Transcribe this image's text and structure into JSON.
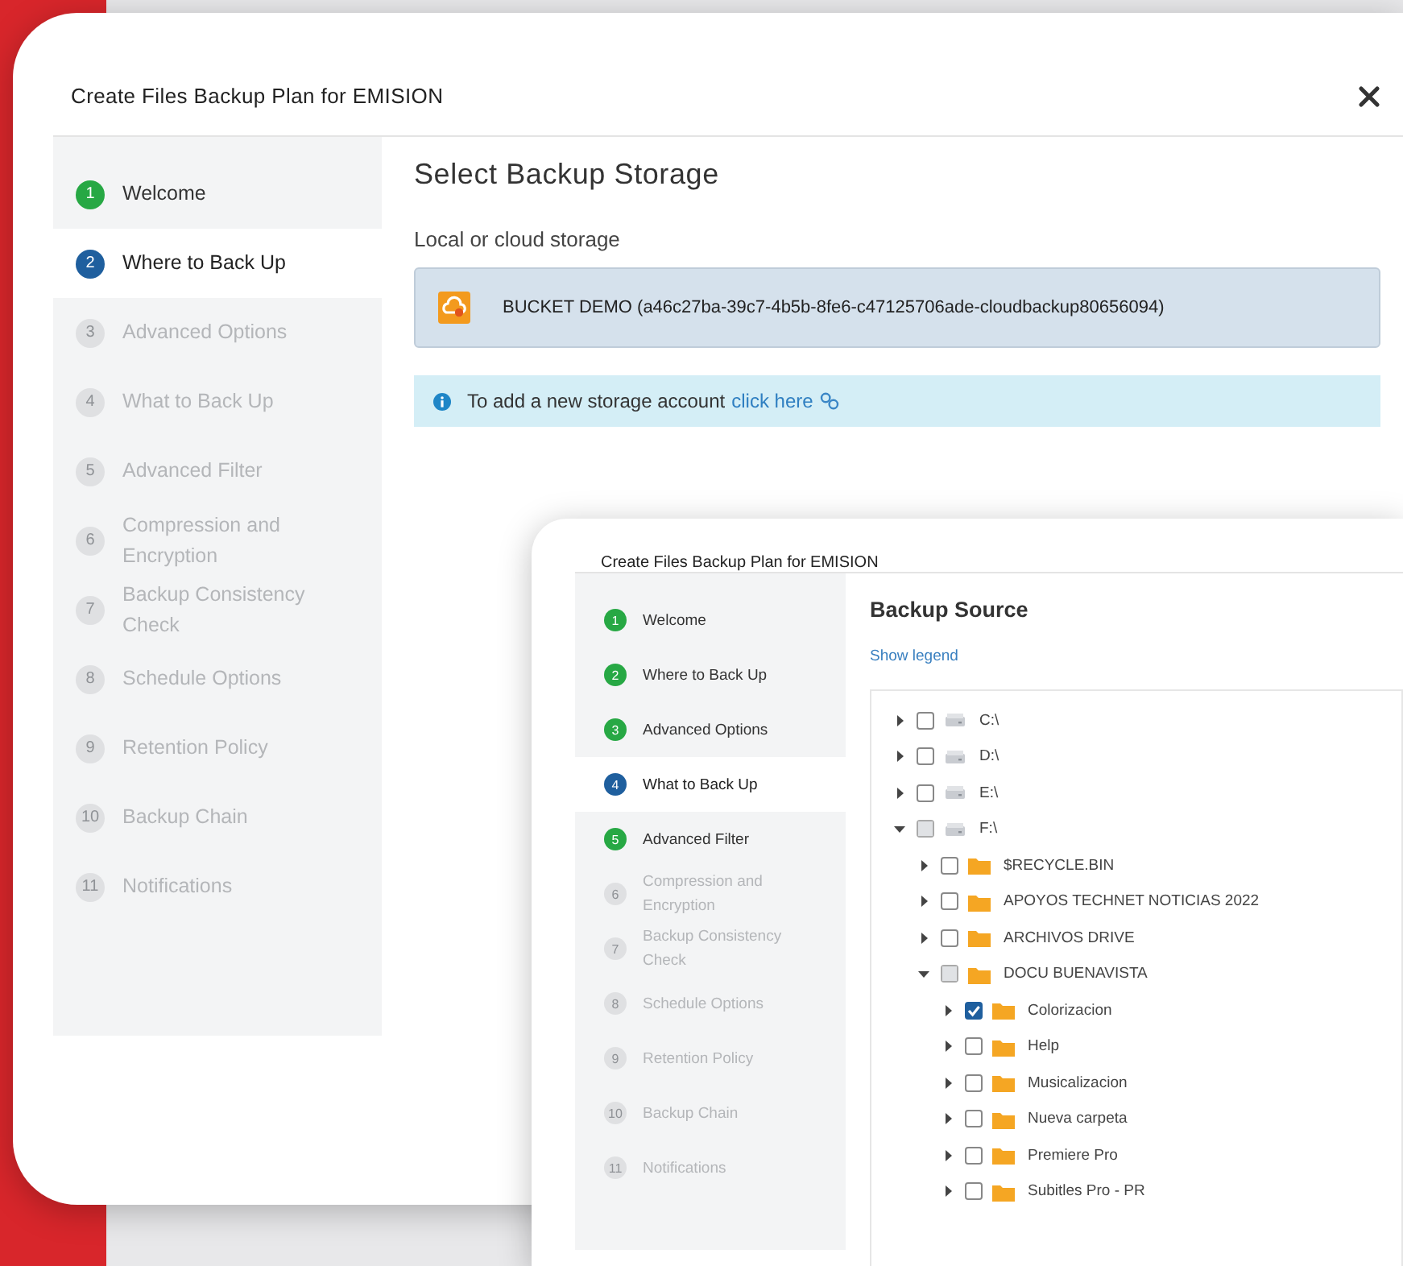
{
  "main_window": {
    "title": "Create Files Backup Plan for EMISION",
    "steps": [
      {
        "number": "1",
        "label": "Welcome",
        "completed": true,
        "selected": false
      },
      {
        "number": "2",
        "label": "Where to Back Up",
        "completed": false,
        "selected": true
      },
      {
        "number": "3",
        "label": "Advanced Options",
        "completed": false,
        "selected": false
      },
      {
        "number": "4",
        "label": "What to Back Up",
        "completed": false,
        "selected": false
      },
      {
        "number": "5",
        "label": "Advanced Filter",
        "completed": false,
        "selected": false
      },
      {
        "number": "6",
        "label": "Compression and Encryption",
        "completed": false,
        "selected": false
      },
      {
        "number": "7",
        "label": "Backup Consistency Check",
        "completed": false,
        "selected": false
      },
      {
        "number": "8",
        "label": "Schedule Options",
        "completed": false,
        "selected": false
      },
      {
        "number": "9",
        "label": "Retention Policy",
        "completed": false,
        "selected": false
      },
      {
        "number": "10",
        "label": "Backup Chain",
        "completed": false,
        "selected": false
      },
      {
        "number": "11",
        "label": "Notifications",
        "completed": false,
        "selected": false
      }
    ],
    "heading": "Select Backup Storage",
    "storage_label": "Local or cloud storage",
    "storage_item": "BUCKET DEMO (a46c27ba-39c7-4b5b-8fe6-c47125706ade-cloudbackup80656094)",
    "info": {
      "text": "To add a new storage account",
      "link": "click here"
    }
  },
  "front_window": {
    "title": "Create Files Backup Plan for EMISION",
    "steps": [
      {
        "number": "1",
        "label": "Welcome",
        "completed": true,
        "selected": false
      },
      {
        "number": "2",
        "label": "Where to Back Up",
        "completed": true,
        "selected": false
      },
      {
        "number": "3",
        "label": "Advanced Options",
        "completed": true,
        "selected": false
      },
      {
        "number": "4",
        "label": "What to Back Up",
        "completed": false,
        "selected": true
      },
      {
        "number": "5",
        "label": "Advanced Filter",
        "completed": true,
        "selected": false
      },
      {
        "number": "6",
        "label": "Compression and Encryption",
        "completed": false,
        "selected": false
      },
      {
        "number": "7",
        "label": "Backup Consistency Check",
        "completed": false,
        "selected": false
      },
      {
        "number": "8",
        "label": "Schedule Options",
        "completed": false,
        "selected": false
      },
      {
        "number": "9",
        "label": "Retention Policy",
        "completed": false,
        "selected": false
      },
      {
        "number": "10",
        "label": "Backup Chain",
        "completed": false,
        "selected": false
      },
      {
        "number": "11",
        "label": "Notifications",
        "completed": false,
        "selected": false
      }
    ],
    "heading": "Backup Source",
    "legend_link": "Show legend",
    "tree": [
      {
        "kind": "drive",
        "label": "C:\\",
        "expanded": false,
        "checked": false,
        "indeterminate": false
      },
      {
        "kind": "drive",
        "label": "D:\\",
        "expanded": false,
        "checked": false,
        "indeterminate": false
      },
      {
        "kind": "drive",
        "label": "E:\\",
        "expanded": false,
        "checked": false,
        "indeterminate": false
      },
      {
        "kind": "drive",
        "label": "F:\\",
        "expanded": true,
        "checked": false,
        "indeterminate": true,
        "children": [
          {
            "kind": "folder",
            "label": "$RECYCLE.BIN",
            "expanded": false,
            "checked": false,
            "indeterminate": false
          },
          {
            "kind": "folder",
            "label": "APOYOS TECHNET NOTICIAS 2022",
            "expanded": false,
            "checked": false,
            "indeterminate": false
          },
          {
            "kind": "folder",
            "label": "ARCHIVOS DRIVE",
            "expanded": false,
            "checked": false,
            "indeterminate": false
          },
          {
            "kind": "folder",
            "label": "DOCU BUENAVISTA",
            "expanded": true,
            "checked": false,
            "indeterminate": true,
            "children": [
              {
                "kind": "folder",
                "label": "Colorizacion",
                "expanded": false,
                "checked": true,
                "indeterminate": false
              },
              {
                "kind": "folder",
                "label": "Help",
                "expanded": false,
                "checked": false,
                "indeterminate": false
              },
              {
                "kind": "folder",
                "label": "Musicalizacion",
                "expanded": false,
                "checked": false,
                "indeterminate": false
              },
              {
                "kind": "folder",
                "label": "Nueva carpeta",
                "expanded": false,
                "checked": false,
                "indeterminate": false
              },
              {
                "kind": "folder",
                "label": "Premiere Pro",
                "expanded": false,
                "checked": false,
                "indeterminate": false
              },
              {
                "kind": "folder",
                "label": "Subitles Pro - PR",
                "expanded": false,
                "checked": false,
                "indeterminate": false
              }
            ]
          }
        ]
      }
    ]
  }
}
